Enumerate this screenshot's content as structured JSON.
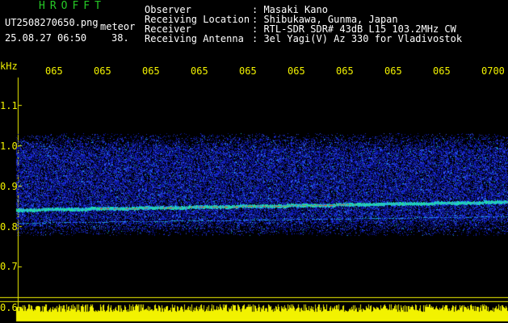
{
  "header": {
    "app_name": "HROFFT",
    "file_name": "UT2508270650.png",
    "mode": "meteor",
    "datetime": "25.08.27 06:50",
    "count": "38."
  },
  "info": {
    "labels": [
      "Observer",
      "Receiving Location",
      "Receiver",
      "Receiving Antenna"
    ],
    "values": [
      ": Masaki Kano",
      ": Shibukawa, Gunma, Japan",
      ": RTL-SDR SDR# 43dB L15 103.2MHz CW",
      ": 3el Yagi(V) Az 330 for Vladivostok"
    ]
  },
  "y_axis": {
    "unit": "kHz",
    "ticks": [
      "1.1",
      "1.0",
      "0.9",
      "0.8",
      "0.7",
      "0.6"
    ]
  },
  "x_axis": {
    "ticks": [
      "065",
      "065",
      "065",
      "065",
      "065",
      "065",
      "065",
      "065",
      "065",
      "0700"
    ]
  },
  "colors": {
    "background": "#000000",
    "text": "#ffffff",
    "title": "#26c926",
    "axis": "#f2f200",
    "signal_low": "#1a2bd8",
    "signal_mid": "#19d1c8",
    "signal_high": "#e83c1e"
  }
}
